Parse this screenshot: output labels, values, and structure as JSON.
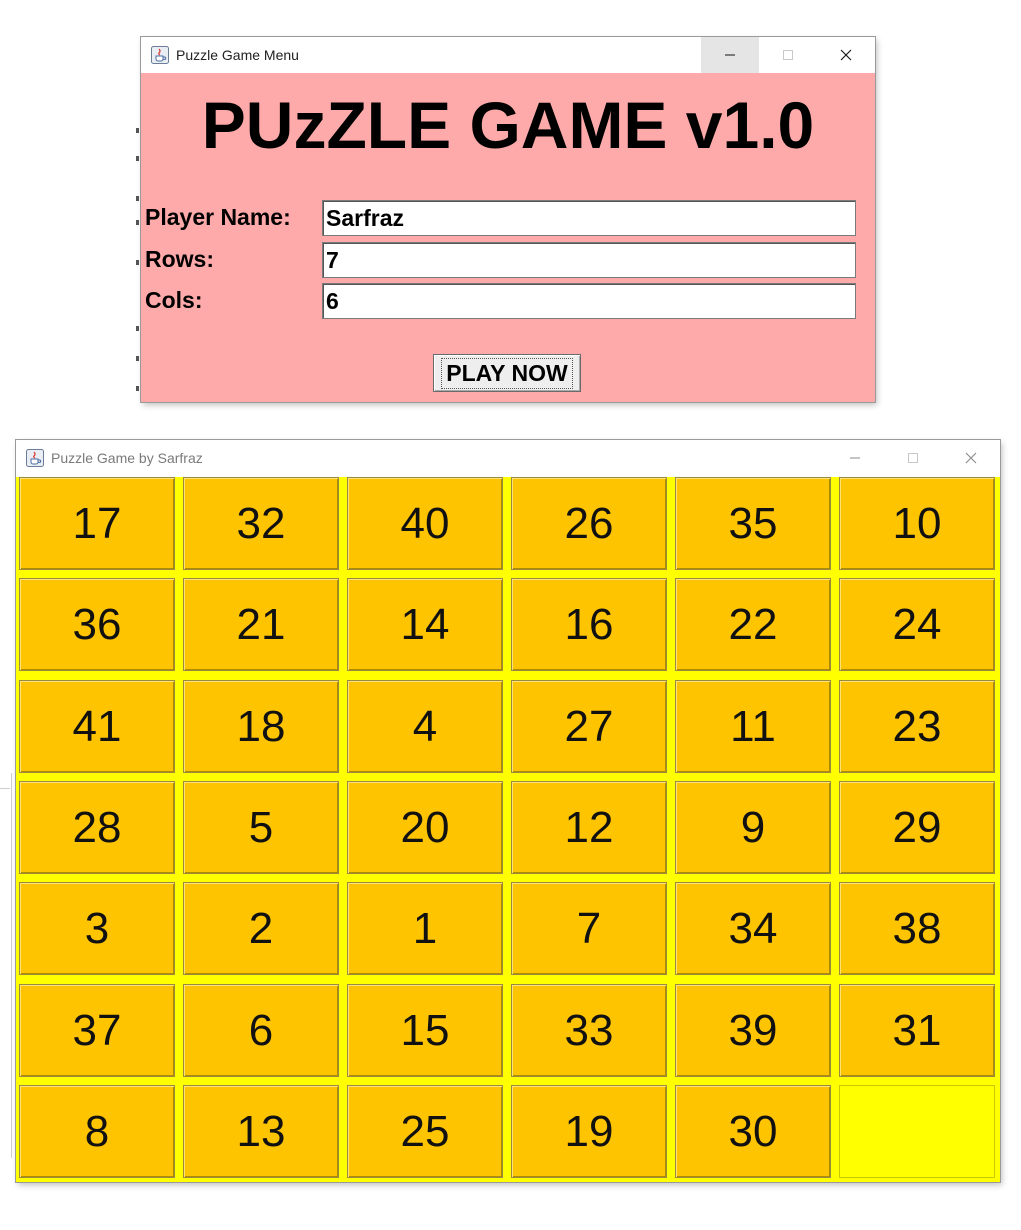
{
  "menu_window": {
    "title": "Puzzle Game Menu",
    "heading": "PUzZLE GAME v1.0",
    "fields": {
      "player_name_label": "Player Name:",
      "player_name_value": "Sarfraz",
      "rows_label": "Rows:",
      "rows_value": "7",
      "cols_label": "Cols:",
      "cols_value": "6"
    },
    "play_button_label": "PLAY NOW",
    "colors": {
      "background": "#ffaaaa"
    }
  },
  "game_window": {
    "title": "Puzzle Game by Sarfraz",
    "colors": {
      "board": "#ffff00",
      "tile": "#ffc400"
    },
    "rows": 7,
    "cols": 6,
    "tiles": [
      [
        "17",
        "32",
        "40",
        "26",
        "35",
        "10"
      ],
      [
        "36",
        "21",
        "14",
        "16",
        "22",
        "24"
      ],
      [
        "41",
        "18",
        "4",
        "27",
        "11",
        "23"
      ],
      [
        "28",
        "5",
        "20",
        "12",
        "9",
        "29"
      ],
      [
        "3",
        "2",
        "1",
        "7",
        "34",
        "38"
      ],
      [
        "37",
        "6",
        "15",
        "33",
        "39",
        "31"
      ],
      [
        "8",
        "13",
        "25",
        "19",
        "30",
        ""
      ]
    ]
  },
  "icons": {
    "app": "java-app-icon",
    "minimize": "minimize-icon",
    "maximize": "maximize-icon",
    "close": "close-icon"
  }
}
